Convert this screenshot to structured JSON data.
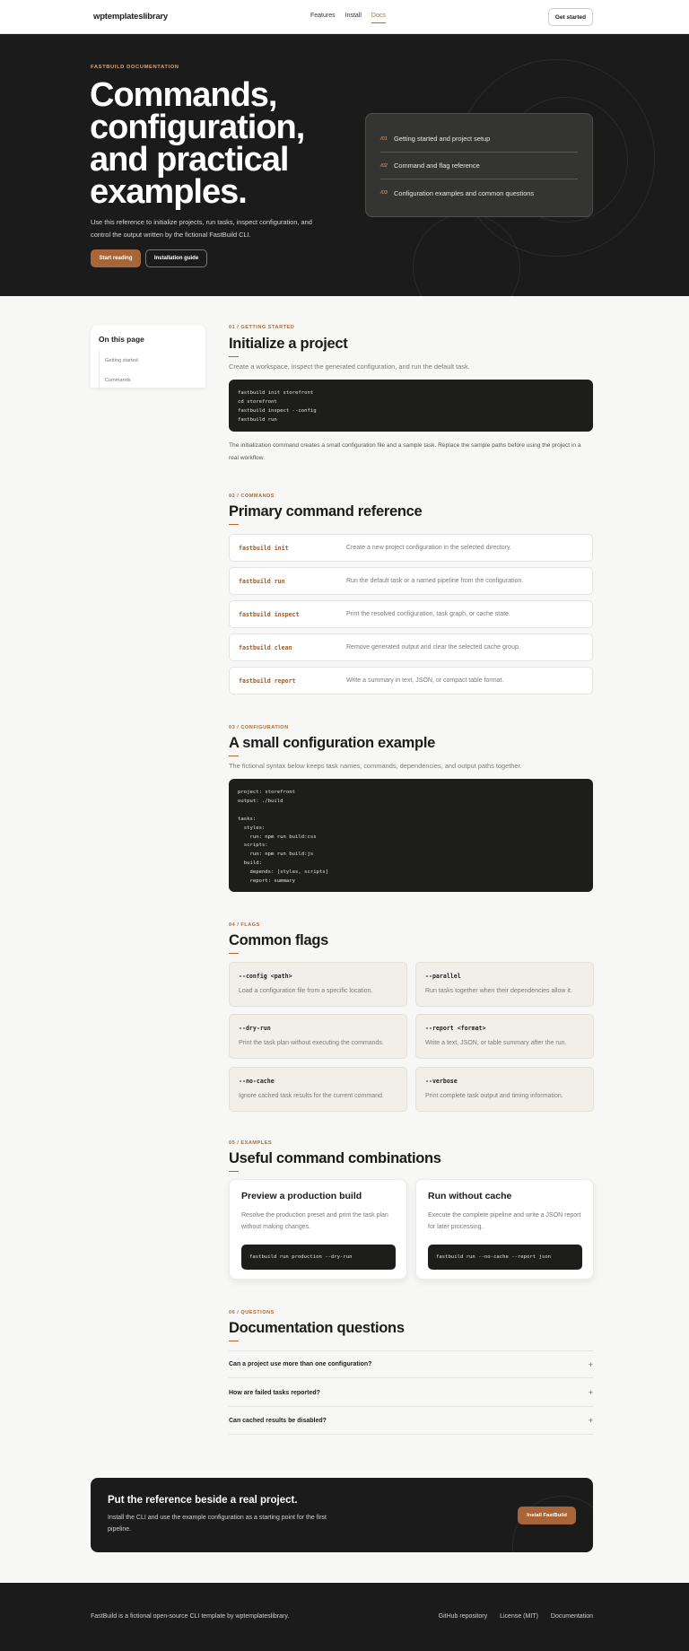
{
  "header": {
    "brand": "wptemplateslibrary",
    "nav": [
      "Features",
      "Install",
      "Docs"
    ],
    "active_nav": "Docs",
    "cta": "Get started"
  },
  "hero": {
    "eyebrow": "FASTBUILD DOCUMENTATION",
    "title": "Commands, configuration, and practical examples.",
    "description": "Use this reference to initialize projects, run tasks, inspect configuration, and control the output written by the fictional FastBuild CLI.",
    "primary_button": "Start reading",
    "secondary_button": "Installation guide",
    "card_items": [
      {
        "num": "/01",
        "label": "Getting started and project setup"
      },
      {
        "num": "/02",
        "label": "Command and flag reference"
      },
      {
        "num": "/03",
        "label": "Configuration examples and common questions"
      }
    ]
  },
  "toc": {
    "title": "On this page",
    "links": [
      "Getting started",
      "Commands"
    ]
  },
  "s1": {
    "eyebrow": "01 / GETTING STARTED",
    "title": "Initialize a project",
    "lead": "Create a workspace, inspect the generated configuration, and run the default task.",
    "code": "fastbuild init storefront\ncd storefront\nfastbuild inspect --config\nfastbuild run",
    "note": "The initialization command creates a small configuration file and a sample task. Replace the sample paths before using the project in a real workflow."
  },
  "s2": {
    "eyebrow": "02 / COMMANDS",
    "title": "Primary command reference",
    "commands": [
      {
        "name": "fastbuild init",
        "desc": "Create a new project configuration in the selected directory."
      },
      {
        "name": "fastbuild run",
        "desc": "Run the default task or a named pipeline from the configuration."
      },
      {
        "name": "fastbuild inspect",
        "desc": "Print the resolved configuration, task graph, or cache state."
      },
      {
        "name": "fastbuild clean",
        "desc": "Remove generated output and clear the selected cache group."
      },
      {
        "name": "fastbuild report",
        "desc": "Write a summary in text, JSON, or compact table format."
      }
    ]
  },
  "s3": {
    "eyebrow": "03 / CONFIGURATION",
    "title": "A small configuration example",
    "lead": "The fictional syntax below keeps task names, commands, dependencies, and output paths together.",
    "code": "project: storefront\noutput: ./build\n\ntasks:\n  styles:\n    run: npm run build:css\n  scripts:\n    run: npm run build:js\n  build:\n    depends: [styles, scripts]\n    report: summary"
  },
  "s4": {
    "eyebrow": "04 / FLAGS",
    "title": "Common flags",
    "flags": [
      {
        "name": "--config <path>",
        "desc": "Load a configuration file from a specific location."
      },
      {
        "name": "--parallel",
        "desc": "Run tasks together when their dependencies allow it."
      },
      {
        "name": "--dry-run",
        "desc": "Print the task plan without executing the commands."
      },
      {
        "name": "--report <format>",
        "desc": "Write a text, JSON, or table summary after the run."
      },
      {
        "name": "--no-cache",
        "desc": "Ignore cached task results for the current command."
      },
      {
        "name": "--verbose",
        "desc": "Print complete task output and timing information."
      }
    ]
  },
  "s5": {
    "eyebrow": "05 / EXAMPLES",
    "title": "Useful command combinations",
    "examples": [
      {
        "title": "Preview a production build",
        "desc": "Resolve the production preset and print the task plan without making changes.",
        "code": "fastbuild run production --dry-run"
      },
      {
        "title": "Run without cache",
        "desc": "Execute the complete pipeline and write a JSON report for later processing.",
        "code": "fastbuild run --no-cache --report json"
      }
    ]
  },
  "s6": {
    "eyebrow": "06 / QUESTIONS",
    "title": "Documentation questions",
    "questions": [
      "Can a project use more than one configuration?",
      "How are failed tasks reported?",
      "Can cached results be disabled?"
    ],
    "expand_symbol": "+"
  },
  "cta": {
    "title": "Put the reference beside a real project.",
    "description": "Install the CLI and use the example configuration as a starting point for the first pipeline.",
    "button": "Install FastBuild"
  },
  "footer": {
    "text": "FastBuild is a fictional open-source CLI template by wptemplateslibrary.",
    "links": [
      "GitHub repository",
      "License (MIT)",
      "Documentation"
    ]
  },
  "colors": {
    "accent": "#b06a36",
    "button_accent": "#a8653a",
    "dark": "#1b1b1b",
    "page_bg": "#f7f7f6",
    "flag_bg": "#f2efe8"
  }
}
